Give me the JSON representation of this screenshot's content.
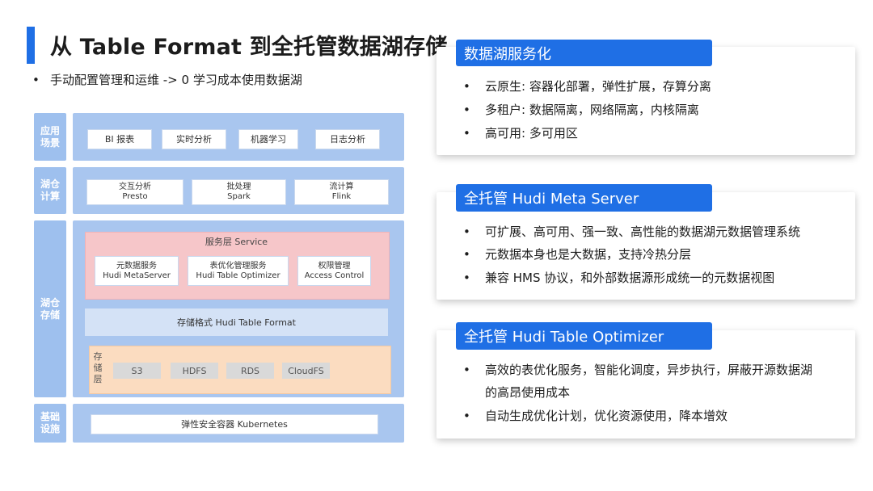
{
  "title": "从 Table Format 到全托管数据湖存储",
  "subtitle": "手动配置管理和运维 -> 0 学习成本使用数据湖",
  "bullet_char": "•",
  "diagram": {
    "rows": {
      "app": {
        "label": "应用\n场景",
        "chips": [
          "BI 报表",
          "实时分析",
          "机器学习",
          "日志分析"
        ]
      },
      "compute": {
        "label": "湖仓\n计算",
        "chips": [
          {
            "cn": "交互分析",
            "en": "Presto"
          },
          {
            "cn": "批处理",
            "en": "Spark"
          },
          {
            "cn": "流计算",
            "en": "Flink"
          }
        ]
      },
      "storage": {
        "label": "湖仓\n存储",
        "service_label": "服务层 Service",
        "services": [
          {
            "cn": "元数据服务",
            "en": "Hudi MetaServer"
          },
          {
            "cn": "表优化管理服务",
            "en": "Hudi Table Optimizer"
          },
          {
            "cn": "权限管理",
            "en": "Access Control"
          }
        ],
        "format_label": "存储格式 Hudi Table Format",
        "storage_layer_label": "存\n储\n层",
        "backends": [
          "S3",
          "HDFS",
          "RDS",
          "CloudFS"
        ]
      },
      "infra": {
        "label": "基础\n设施",
        "chip": "弹性安全容器 Kubernetes"
      }
    }
  },
  "cards": [
    {
      "heading": "数据湖服务化",
      "bullets": [
        "云原生: 容器化部署，弹性扩展，存算分离",
        "多租户: 数据隔离，网络隔离，内核隔离",
        "高可用: 多可用区"
      ]
    },
    {
      "heading": "全托管 Hudi Meta Server",
      "bullets": [
        "可扩展、高可用、强一致、高性能的数据湖元数据管理系统",
        "元数据本身也是大数据，支持冷热分层",
        "兼容 HMS 协议，和外部数据源形成统一的元数据视图"
      ]
    },
    {
      "heading": "全托管 Hudi Table Optimizer",
      "bullets": [
        "高效的表优化服务，智能化调度，异步执行，屏蔽开源数据湖",
        "的高昂使用成本",
        "自动生成优化计划，优化资源使用，降本增效"
      ]
    }
  ]
}
